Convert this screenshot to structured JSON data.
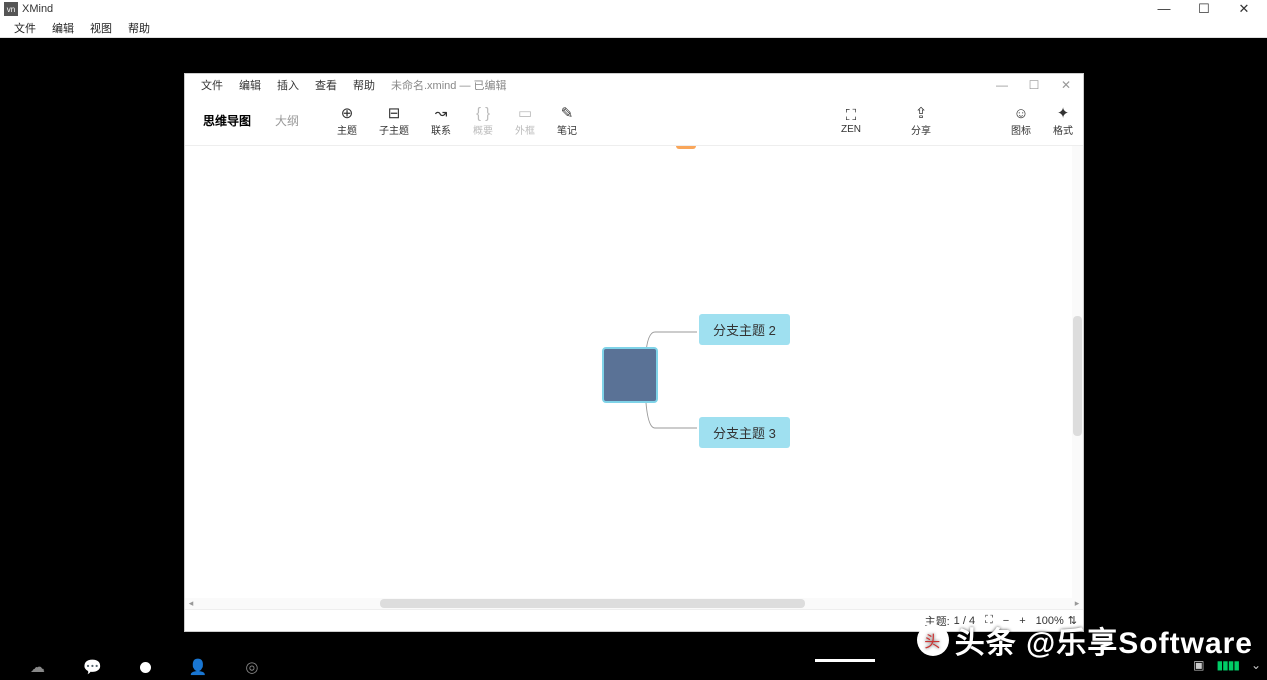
{
  "outer": {
    "app_name": "XMind",
    "menu": [
      "文件",
      "编辑",
      "视图",
      "帮助"
    ],
    "controls": {
      "min": "—",
      "max": "☐",
      "close": "✕"
    }
  },
  "inner": {
    "menu": [
      "文件",
      "编辑",
      "插入",
      "查看",
      "帮助"
    ],
    "doc_title": "未命名.xmind — 已编辑",
    "controls": {
      "min": "—",
      "max": "☐",
      "close": "✕"
    },
    "view_tabs": {
      "mindmap": "思维导图",
      "outline": "大纲"
    },
    "tools": {
      "topic": "主题",
      "subtopic": "子主题",
      "relation": "联系",
      "summary": "概要",
      "border": "外框",
      "note": "笔记",
      "zen": "ZEN",
      "share": "分享",
      "icon": "图标",
      "format": "格式"
    },
    "nodes": {
      "branch2": "分支主题 2",
      "branch3": "分支主题 3"
    },
    "status": {
      "topic_label": "主题:",
      "topic_count": "1 / 4",
      "zoom": "100%"
    }
  },
  "watermark": "头条 @乐享Software"
}
